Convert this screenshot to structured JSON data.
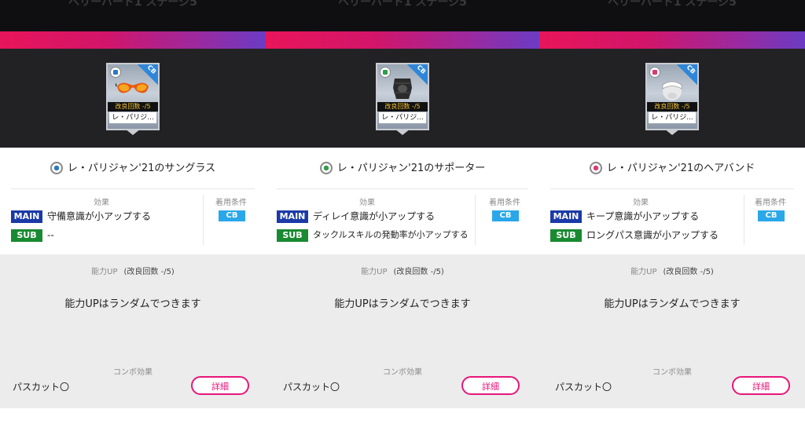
{
  "panels": [
    {
      "header_ghost": "ベリーハード1 ステージ5",
      "card": {
        "category_color": "blue",
        "position": "CB",
        "improve": "改良回数 -/5",
        "short_name": "レ・パリジ..."
      },
      "title": "レ・パリジャン'21のサングラス",
      "effect_header": "効果",
      "condition_header": "着用条件",
      "main_tag": "MAIN",
      "main_effect": "守備意識が小アップする",
      "sub_tag": "SUB",
      "sub_effect": "--",
      "condition": "CB",
      "ability_header": "能力UP",
      "ability_improve": "(改良回数 -/5)",
      "ability_text": "能力UPはランダムでつきます",
      "combo_header": "コンボ効果",
      "combo_text": "パスカット〇",
      "detail_button": "詳細"
    },
    {
      "header_ghost": "ベリーハード1 ステージ5",
      "card": {
        "category_color": "green",
        "position": "CB",
        "improve": "改良回数 -/5",
        "short_name": "レ・パリジ..."
      },
      "title": "レ・パリジャン'21のサポーター",
      "effect_header": "効果",
      "condition_header": "着用条件",
      "main_tag": "MAIN",
      "main_effect": "ディレイ意識が小アップする",
      "sub_tag": "SUB",
      "sub_effect": "タックルスキルの発動率が小アップする",
      "condition": "CB",
      "ability_header": "能力UP",
      "ability_improve": "(改良回数 -/5)",
      "ability_text": "能力UPはランダムでつきます",
      "combo_header": "コンボ効果",
      "combo_text": "パスカット〇",
      "detail_button": "詳細"
    },
    {
      "header_ghost": "ベリーハード1 ステージ5",
      "card": {
        "category_color": "pink",
        "position": "CB",
        "improve": "改良回数 -/5",
        "short_name": "レ・パリジ..."
      },
      "title": "レ・パリジャン'21のヘアバンド",
      "effect_header": "効果",
      "condition_header": "着用条件",
      "main_tag": "MAIN",
      "main_effect": "キープ意識が小アップする",
      "sub_tag": "SUB",
      "sub_effect": "ロングパス意識が小アップする",
      "condition": "CB",
      "ability_header": "能力UP",
      "ability_improve": "(改良回数 -/5)",
      "ability_text": "能力UPはランダムでつきます",
      "combo_header": "コンボ効果",
      "combo_text": "パスカット〇",
      "detail_button": "詳細"
    }
  ],
  "colors": {
    "gradient_start": "#e8155a",
    "gradient_end": "#6a3cc4",
    "main_tag": "#1b3aa8",
    "sub_tag": "#1a8a32",
    "cb_badge": "#2aa7e8",
    "detail_button": "#e8157a"
  },
  "icons": {
    "panel0": "sunglasses-icon",
    "panel1": "knee-supporter-icon",
    "panel2": "headband-icon"
  }
}
